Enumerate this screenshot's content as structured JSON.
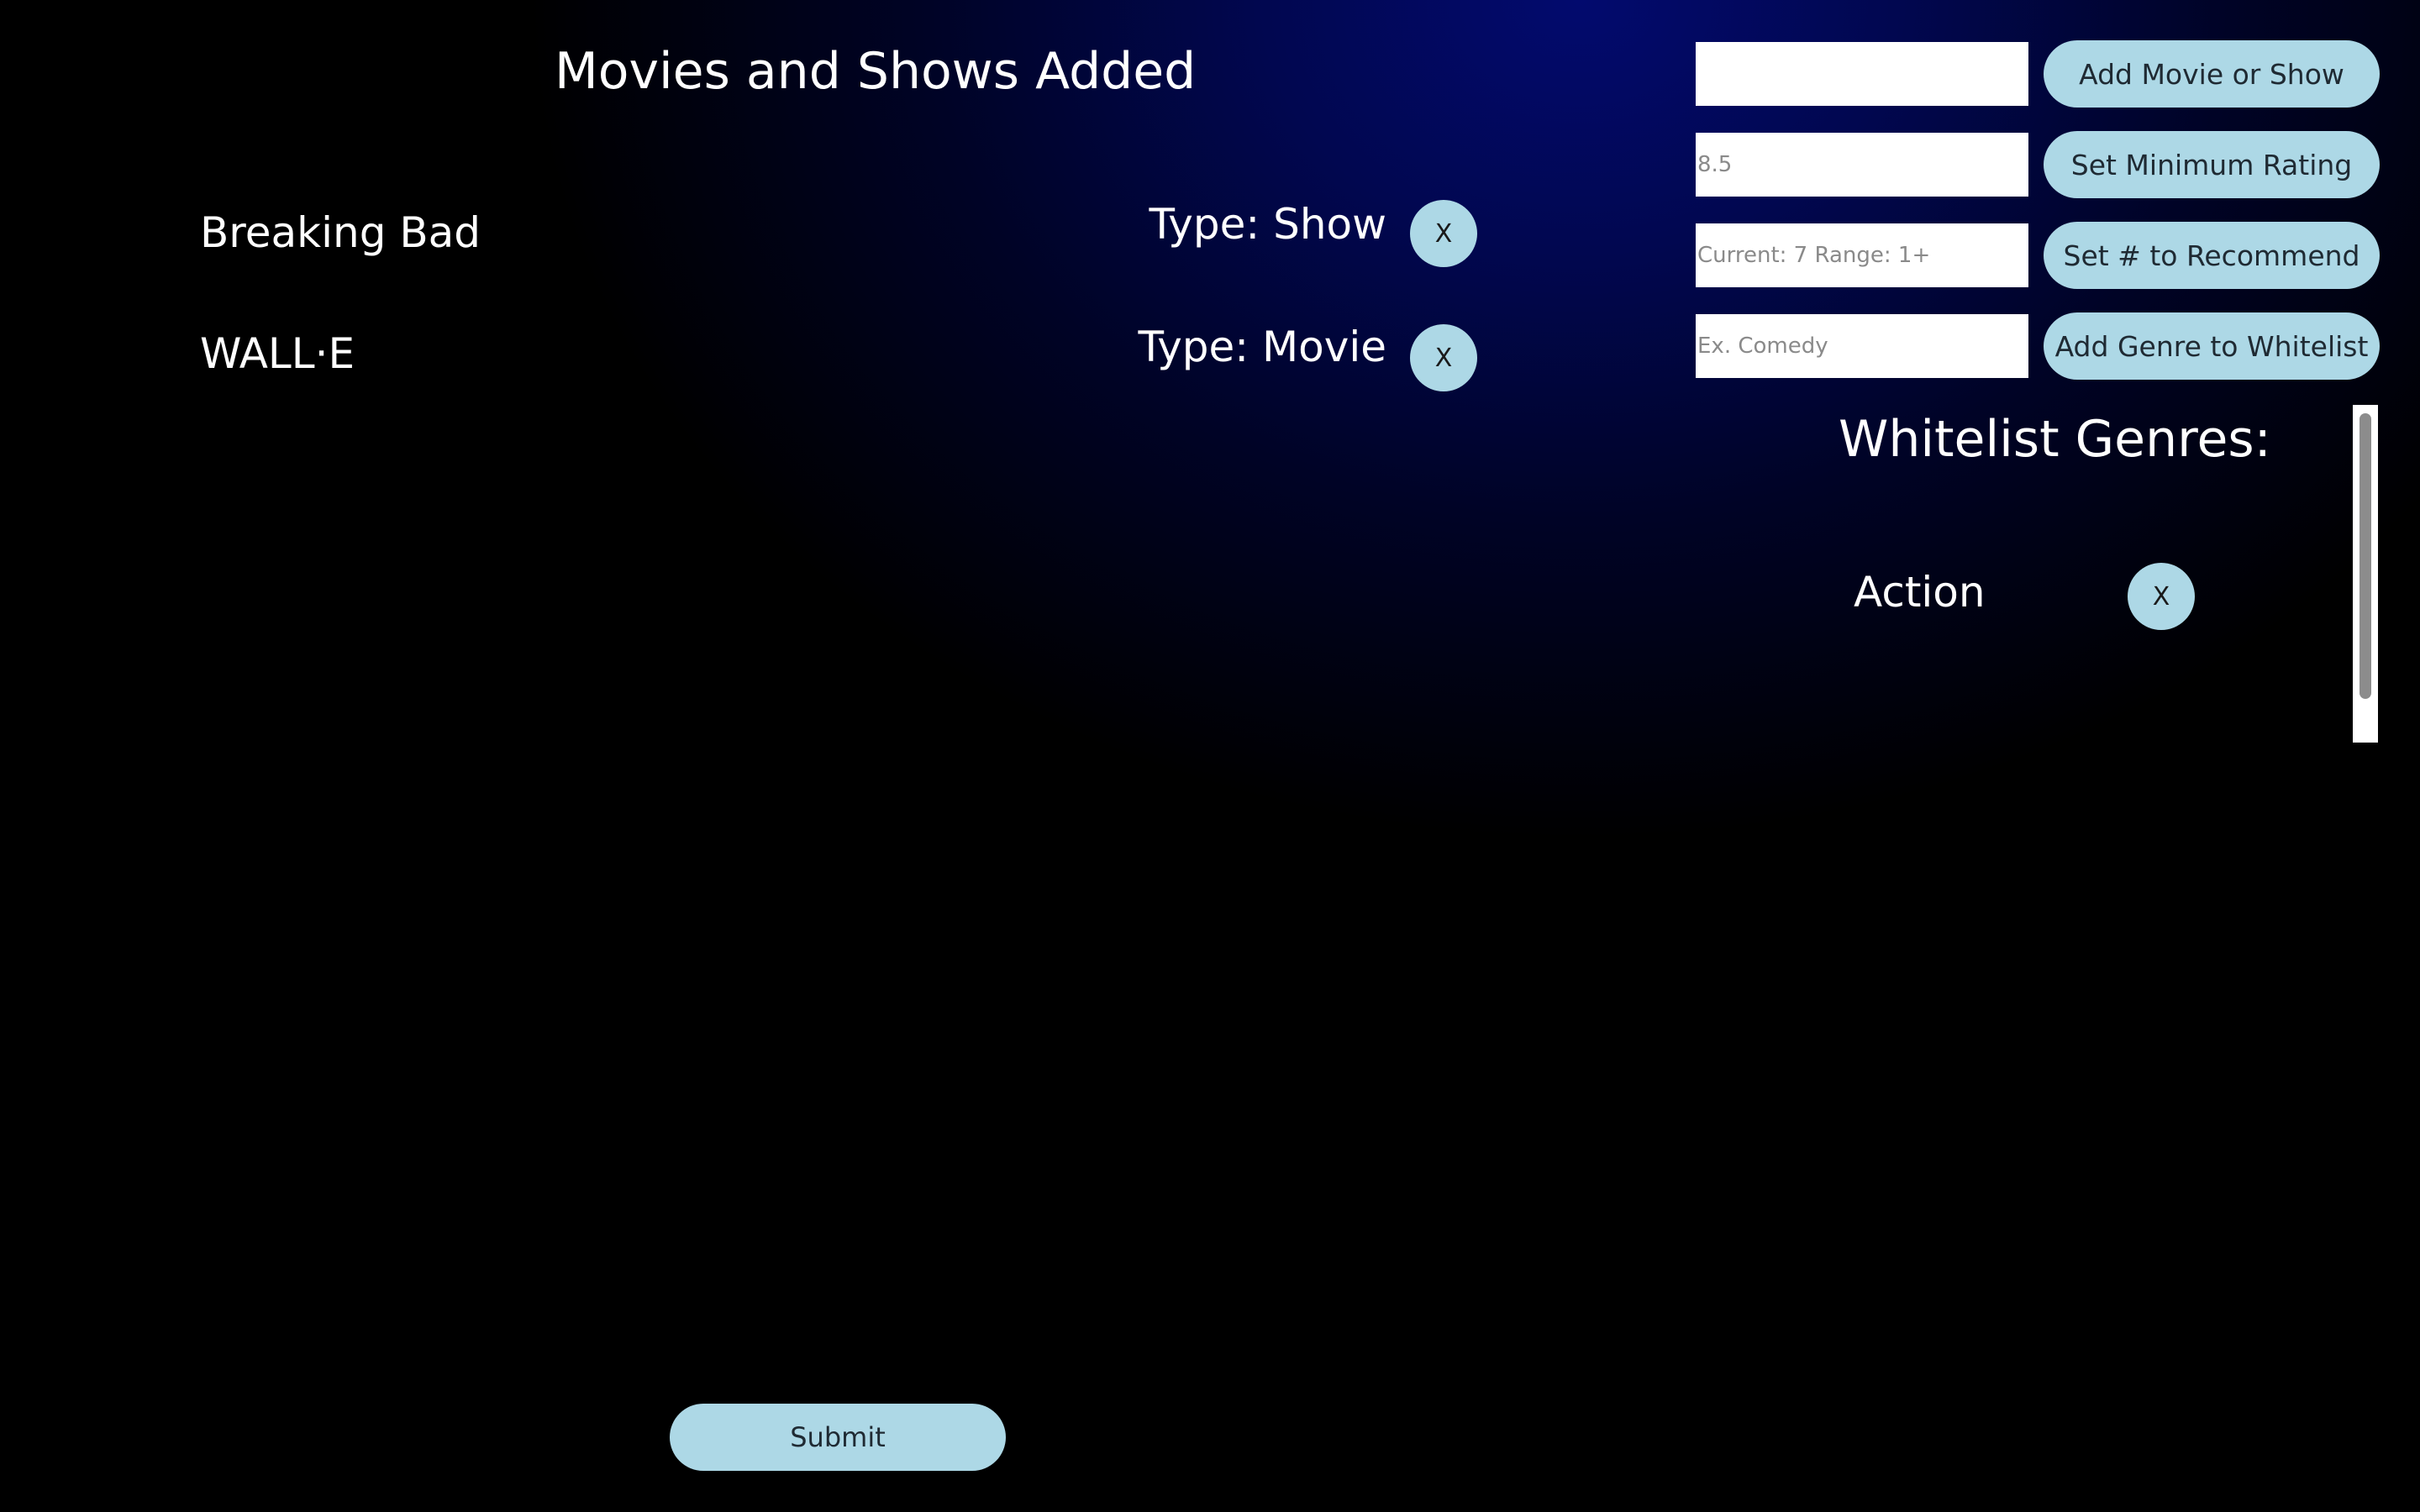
{
  "main": {
    "title": "Movies and Shows Added",
    "items": [
      {
        "title": "Breaking Bad",
        "type_label": "Type: Show",
        "remove_label": "X"
      },
      {
        "title": "WALL·E",
        "type_label": "Type: Movie",
        "remove_label": "X"
      }
    ],
    "submit_label": "Submit"
  },
  "controls": {
    "add_title": {
      "value": "",
      "placeholder": "",
      "button_label": "Add Movie or Show"
    },
    "min_rating": {
      "value": "",
      "placeholder": "8.5",
      "button_label": "Set Minimum Rating"
    },
    "recommend_count": {
      "value": "",
      "placeholder": "Current: 7 Range: 1+",
      "button_label": "Set # to Recommend"
    },
    "genre": {
      "value": "",
      "placeholder": "Ex. Comedy",
      "button_label": "Add Genre to Whitelist"
    }
  },
  "whitelist": {
    "title": "Whitelist Genres:",
    "genres": [
      {
        "name": "Action",
        "remove_label": "X"
      }
    ]
  },
  "colors": {
    "button_fill": "#add8e6",
    "background_accent": "#020a6e",
    "text": "#ffffff"
  }
}
